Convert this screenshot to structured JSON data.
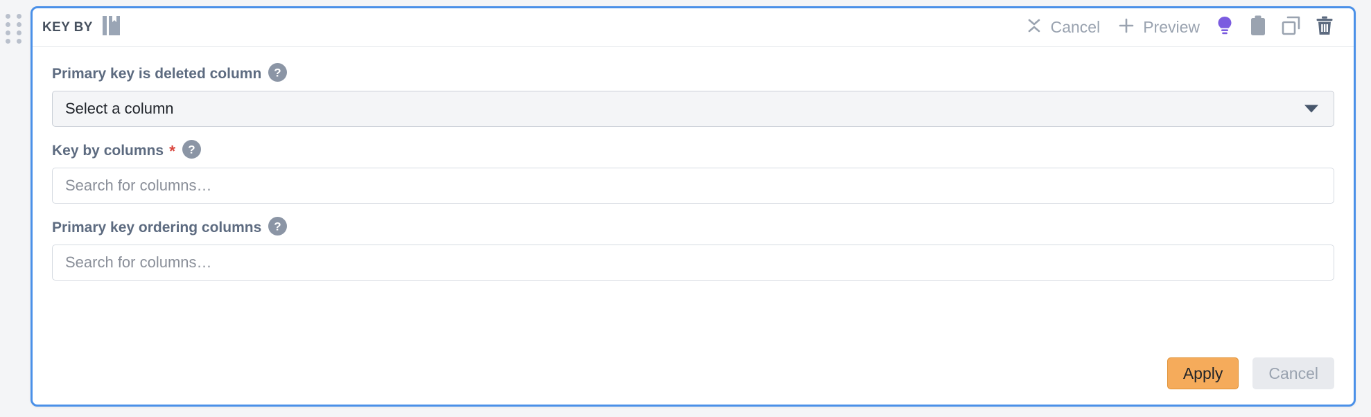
{
  "card": {
    "title": "KEY BY",
    "title_icon": "book-icon",
    "drag_handle_icon": "drag-handle-dots-icon",
    "border_color": "#4a90e8",
    "background": "#ffffff"
  },
  "header_actions": [
    {
      "icon": "collapse-icon",
      "label": "Cancel",
      "name": "header-cancel-action"
    },
    {
      "icon": "plus-icon",
      "label": "Preview",
      "name": "header-preview-action"
    }
  ],
  "header_icons": [
    {
      "icon": "lightbulb-icon",
      "name": "hint-button",
      "color": "#7b5ce0"
    },
    {
      "icon": "clipboard-icon",
      "name": "clipboard-button",
      "color": "#9aa3b0"
    },
    {
      "icon": "duplicate-icon",
      "name": "duplicate-button",
      "color": "#9aa3b0"
    },
    {
      "icon": "trash-icon",
      "name": "delete-button",
      "color": "#5d6b80"
    }
  ],
  "fields": [
    {
      "label": "Primary key is deleted column",
      "required": false,
      "required_marker": "",
      "help_icon": "help-circle-icon",
      "control": "select",
      "value": "Select a column",
      "arrow_icon": "chevron-down-icon"
    },
    {
      "label": "Key by columns",
      "required": true,
      "required_marker": "*",
      "help_icon": "help-circle-icon",
      "control": "search",
      "value": "",
      "placeholder": "Search for columns…"
    },
    {
      "label": "Primary key ordering columns",
      "required": false,
      "required_marker": "",
      "help_icon": "help-circle-icon",
      "control": "search",
      "value": "",
      "placeholder": "Search for columns…"
    }
  ],
  "footer": {
    "apply_label": "Apply",
    "cancel_label": "Cancel",
    "apply_color": "#f5ab5b",
    "cancel_color": "#e8eaee"
  }
}
